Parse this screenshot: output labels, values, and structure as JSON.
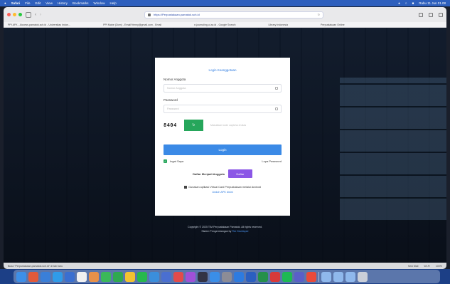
{
  "menubar": {
    "app": "Safari",
    "items": [
      "File",
      "Edit",
      "View",
      "History",
      "Bookmarks",
      "Window",
      "Help"
    ],
    "clock": "Rabu 11 Jun 01.08"
  },
  "browser": {
    "url": "https://Perpustakaan.pamatok.sch.id",
    "bookmarks": [
      "PPI AFK - Aiccess.pamatok.sch.id - Universitas Indon...",
      "PPI Mahe (Dom) - Email/Yenny@gmail.com - Email",
      "e-journaling.ui.ac.id - Google Search",
      "Library Indonesia",
      "Perpustakaan Online"
    ]
  },
  "login": {
    "title": "Login Keanggotaan",
    "member_label": "Nomor Anggota",
    "member_placeholder": "Nomor Anggota",
    "password_label": "Password",
    "password_placeholder": "Password",
    "captcha_code": "8404",
    "captcha_placeholder": "Masukkan kode captcha di atas",
    "login_button": "Login",
    "remember_label": "Ingat Saya",
    "forgot_label": "Lupa Password",
    "register_prompt": "Daftar Menjadi Anggota",
    "register_button": "Daftar",
    "notice": "Gunakan aplikasi Virtual Card Perpustakaan melalui Android",
    "notice_link": "Unduh APK disini"
  },
  "footer": {
    "line1": "Copyright © 2025 TIM Perpustakaan Pamatok. All rights reserved.",
    "line2_prefix": "Sistem Pengembangan by",
    "line2_link": "Tim Developer"
  },
  "statusbar": {
    "left": "Buka \"Perpustakaan.pamatok.sch.id\" di tab baru",
    "right": [
      "Sesi Mail",
      "Wi-Fi",
      "100%"
    ]
  },
  "dock": {
    "apps": [
      {
        "name": "finder-icon",
        "color": "#3d8fe8"
      },
      {
        "name": "launchpad-icon",
        "color": "#e25a3a"
      },
      {
        "name": "mail-icon",
        "color": "#3a7fd8"
      },
      {
        "name": "safari-icon",
        "color": "#2f9be8"
      },
      {
        "name": "notes-icon",
        "color": "#3a6fd0"
      },
      {
        "name": "calendar-icon",
        "color": "#f0f0f0"
      },
      {
        "name": "photos-icon",
        "color": "#e8914a"
      },
      {
        "name": "messages-icon",
        "color": "#3bb85a"
      },
      {
        "name": "facetime-icon",
        "color": "#2fa84f"
      },
      {
        "name": "chrome-icon",
        "color": "#f2c230"
      },
      {
        "name": "whatsapp-icon",
        "color": "#27b84d"
      },
      {
        "name": "maps-icon",
        "color": "#3b8edc"
      },
      {
        "name": "files-icon",
        "color": "#4a6fd0"
      },
      {
        "name": "music-icon",
        "color": "#e24b4b"
      },
      {
        "name": "podcasts-icon",
        "color": "#a050d8"
      },
      {
        "name": "tv-icon",
        "color": "#333344"
      },
      {
        "name": "appstore-icon",
        "color": "#3a8ee8"
      },
      {
        "name": "settings-icon",
        "color": "#8c8c96"
      },
      {
        "name": "zoom-icon",
        "color": "#2d7be0"
      },
      {
        "name": "word-icon",
        "color": "#2b5fc0"
      },
      {
        "name": "excel-icon",
        "color": "#25904a"
      },
      {
        "name": "pdf-icon",
        "color": "#d83a3a"
      },
      {
        "name": "spotify-icon",
        "color": "#1db954"
      },
      {
        "name": "teams-icon",
        "color": "#5a5fc8"
      },
      {
        "name": "vpn-icon",
        "color": "#e84a3a"
      },
      {
        "name": "folder-downloads-icon",
        "color": "#8fb8ec"
      },
      {
        "name": "folder-documents-icon",
        "color": "#8fb8ec"
      },
      {
        "name": "folder-desktop-icon",
        "color": "#8fb8ec"
      },
      {
        "name": "trash-icon",
        "color": "#c9ced8"
      }
    ]
  }
}
